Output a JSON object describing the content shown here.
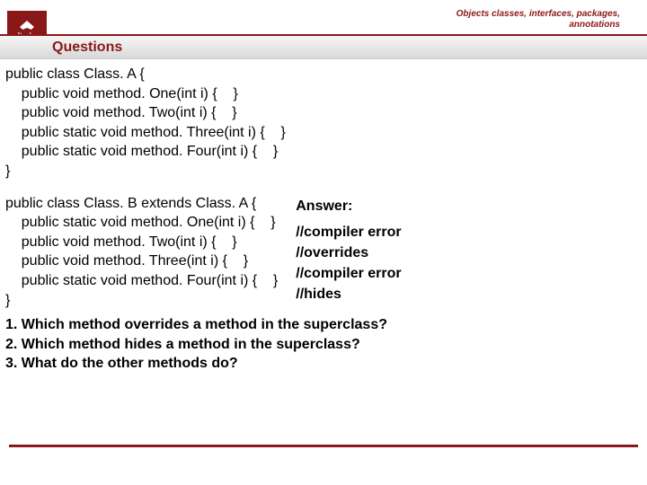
{
  "header": {
    "topic_line1": "Objects classes, interfaces, packages,",
    "topic_line2": "annotations"
  },
  "logo": {
    "letters": "P   L"
  },
  "title": "Questions",
  "classA": {
    "l1": "public class Class. A {",
    "l2": "    public void method. One(int i) {    }",
    "l3": "    public void method. Two(int i) {    }",
    "l4": "    public static void method. Three(int i) {    }",
    "l5": "    public static void method. Four(int i) {    }",
    "l6": "}"
  },
  "classB": {
    "l1": "public class Class. B extends Class. A {",
    "l2": "    public static void method. One(int i) {    }",
    "l3": "    public void method. Two(int i) {    }",
    "l4": "    public void method. Three(int i) {    }",
    "l5": "    public static void method. Four(int i) {    }",
    "l6": "}"
  },
  "answer": {
    "heading": "Answer:",
    "a1": "//compiler error",
    "a2": "//overrides",
    "a3": "//compiler error",
    "a4": "//hides"
  },
  "questions": {
    "q1": "1. Which method overrides a method in the superclass?",
    "q2": "2. Which method hides a method in the superclass?",
    "q3": "3. What do the other methods do?"
  }
}
